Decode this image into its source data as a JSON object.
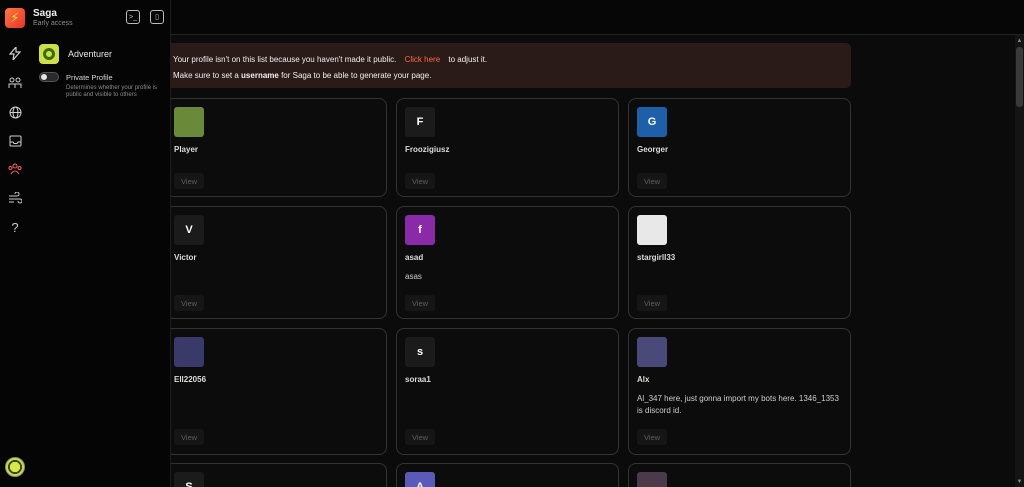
{
  "app": {
    "name": "Saga",
    "subtitle": "Early access"
  },
  "rail_icons": [
    "lightning-icon",
    "people-icon",
    "globe-icon",
    "inbox-icon",
    "community-icon",
    "wind-icon",
    "help-icon"
  ],
  "help_glyph": "?",
  "sidebar": {
    "tier": "Adventurer",
    "private_profile_label": "Private Profile",
    "private_profile_desc": "Determines whether your profile is public and visible to others",
    "private_profile_on": false
  },
  "notice": {
    "line1_before": "Your profile isn't on this list because you haven't made it public.",
    "link": "Click here",
    "line1_after": "to adjust it.",
    "line2_before": "Make sure to set a",
    "line2_bold": "username",
    "line2_after": "for Saga to be able to generate your page."
  },
  "view_label": "View",
  "cards": [
    {
      "name": "Player",
      "initial": "",
      "bio": "",
      "color": "#6a8a3a"
    },
    {
      "name": "Froozigiusz",
      "initial": "F",
      "bio": "",
      "color": "#1b1b1b"
    },
    {
      "name": "Georger",
      "initial": "G",
      "bio": "",
      "color": "#1d5fa8"
    },
    {
      "name": "Victor",
      "initial": "V",
      "bio": "",
      "color": "#1b1b1b"
    },
    {
      "name": "asad",
      "initial": "f",
      "bio": "asas",
      "color": "#8a2aa8"
    },
    {
      "name": "stargirll33",
      "initial": "",
      "bio": "",
      "color": "#e8e8e8"
    },
    {
      "name": "Ell22056",
      "initial": "",
      "bio": "",
      "color": "#3a3a6a"
    },
    {
      "name": "soraa1",
      "initial": "s",
      "bio": "",
      "color": "#1b1b1b"
    },
    {
      "name": "Alx",
      "initial": "",
      "bio": "Al_347 here, just gonna import my bots here. 1346_1353 is discord id.",
      "color": "#4a4a7a"
    },
    {
      "name": "",
      "initial": "S",
      "bio": "",
      "color": "#1b1b1b"
    },
    {
      "name": "",
      "initial": "A",
      "bio": "",
      "color": "#5a5ab8"
    },
    {
      "name": "",
      "initial": "",
      "bio": "",
      "color": "#4a3a4a"
    }
  ]
}
